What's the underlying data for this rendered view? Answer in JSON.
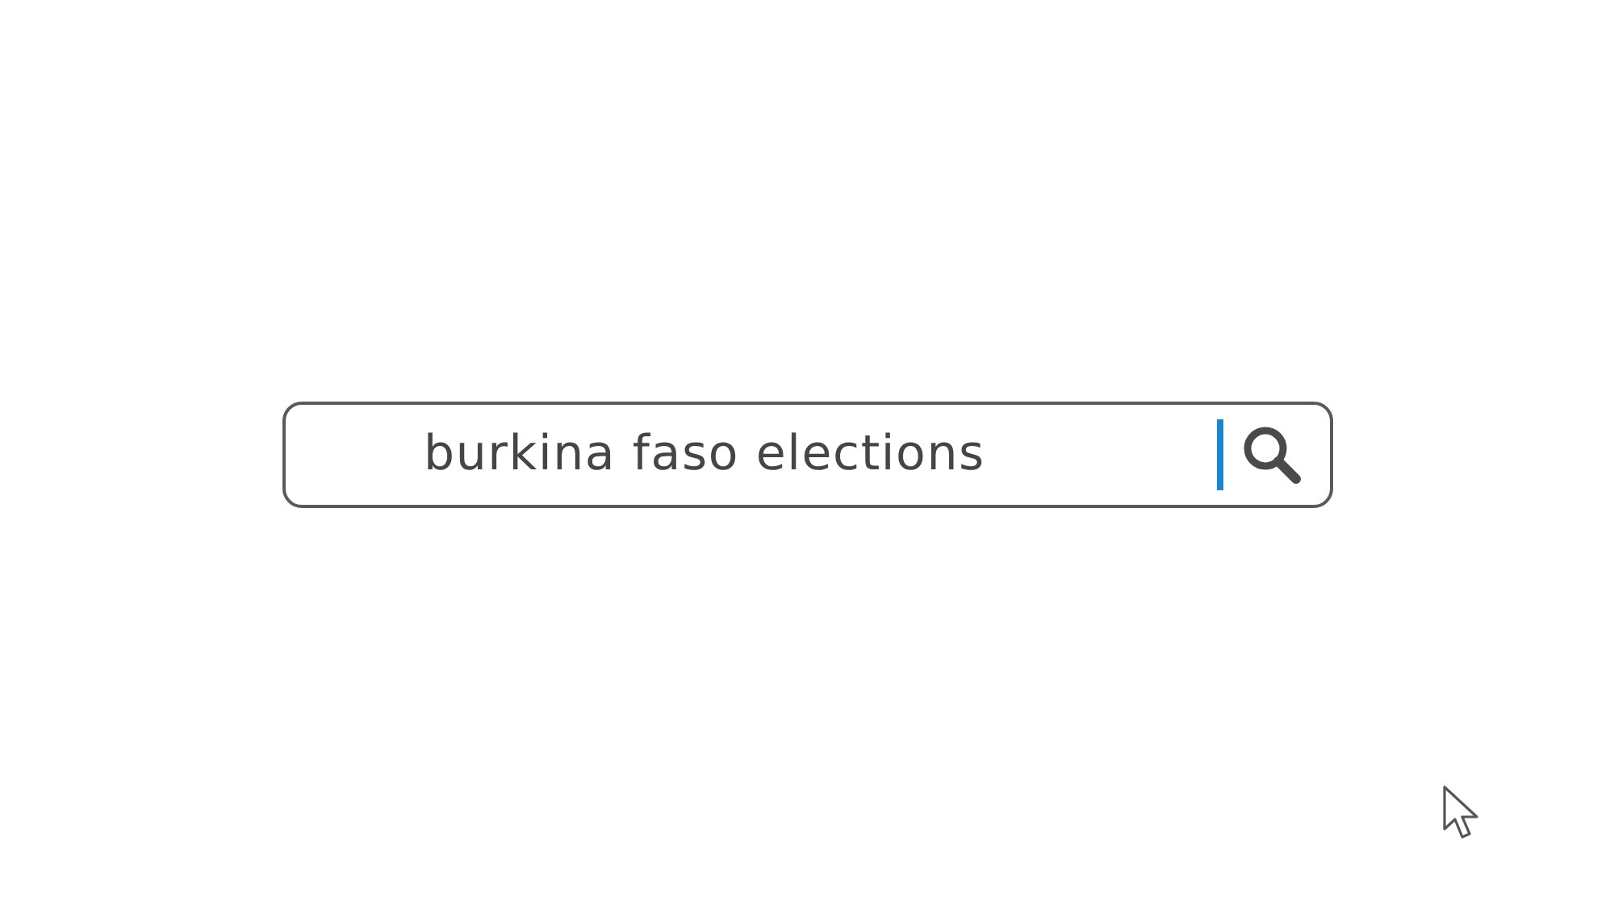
{
  "search": {
    "value": "burkina faso elections",
    "focused": true
  }
}
